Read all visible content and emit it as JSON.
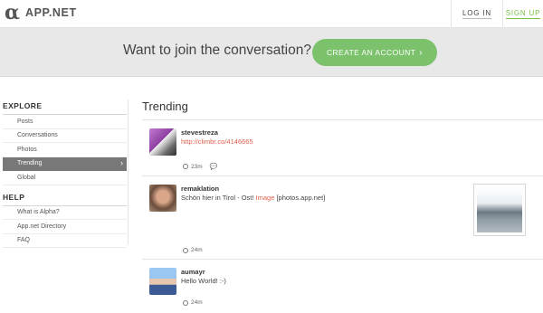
{
  "header": {
    "logo_mark": "α",
    "logo_text": "APP.NET",
    "login_label": "LOG IN",
    "signup_label": "SIGN UP"
  },
  "banner": {
    "text": "Want to join the conversation?",
    "cta_label": "CREATE AN ACCOUNT",
    "cta_icon": "›",
    "cta_color": "#7cc16b"
  },
  "sidebar": {
    "explore_heading": "EXPLORE",
    "explore_items": [
      {
        "label": "Posts"
      },
      {
        "label": "Conversations"
      },
      {
        "label": "Photos"
      },
      {
        "label": "Trending",
        "active": true,
        "arrow": "›"
      },
      {
        "label": "Global"
      }
    ],
    "help_heading": "HELP",
    "help_items": [
      {
        "label": "What is Alpha?"
      },
      {
        "label": "App.net Directory"
      },
      {
        "label": "FAQ"
      }
    ]
  },
  "feed": {
    "title": "Trending",
    "posts": [
      {
        "username": "stevestreza",
        "link": "http://climbr.co/4146665",
        "time": "23m",
        "reply_icon": "chat-bubble-icon"
      },
      {
        "username": "remaklation",
        "text": "Schön hier in Tirol - Ost! ",
        "image_link": "Image",
        "text_after": " [photos.app.net]",
        "time": "24m"
      },
      {
        "username": "aumayr",
        "text": "Hello World! :-)",
        "time": "24m"
      }
    ]
  },
  "colors": {
    "accent_green": "#7ac143",
    "link_red": "#e0604a",
    "active_nav": "#787878"
  }
}
